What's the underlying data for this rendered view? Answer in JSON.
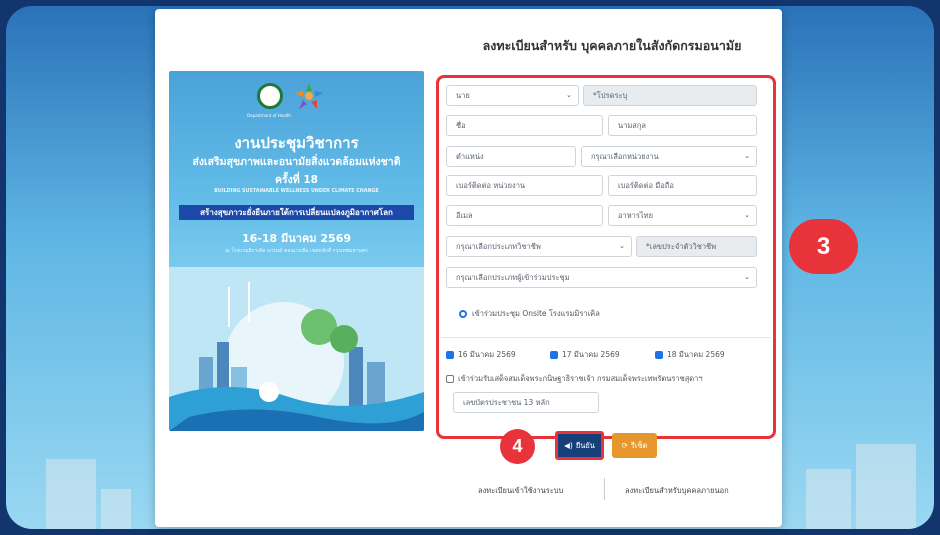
{
  "page": {
    "title": "ลงทะเบียนสำหรับ บุคคลภายในสังกัดกรมอนามัย"
  },
  "poster": {
    "logo_caption": "Department of Health",
    "title_line1": "งานประชุมวิชาการ",
    "title_line2": "ส่งเสริมสุขภาพและอนามัยสิ่งแวดล้อมแห่งชาติ",
    "title_line3": "ครั้งที่ 18",
    "subtitle_en": "BUILDING SUSTAINABLE WELLNESS UNDER CLIMATE CHANGE",
    "banner": "สร้างสุขภาวะยั่งยืนภายใต้การเปลี่ยนแปลงภูมิอากาศโลก",
    "date": "16-18 มีนาคม 2569",
    "venue": "ณ โรงแรมมิราเคิล แกรนด์ คอนเวนชั่น เขตหลักสี่ กรุงเทพมหานคร"
  },
  "form": {
    "title_select": "นาย",
    "title_other_placeholder": "*โปรดระบุ",
    "first_name_placeholder": "ชื่อ",
    "last_name_placeholder": "นามสกุล",
    "position_placeholder": "ตำแหน่ง",
    "unit_select": "กรุณาเลือกหน่วยงาน",
    "office_phone_placeholder": "เบอร์ติดต่อ หน่วยงาน",
    "mobile_placeholder": "เบอร์ติดต่อ มือถือ",
    "email_placeholder": "อีเมล",
    "food_select": "อาหารไทย",
    "profession_select": "กรุณาเลือกประเภทวิชาชีพ",
    "license_placeholder": "*เลขประจำตัววิชาชีพ",
    "attendee_type_select": "กรุณาเลือกประเภทผู้เข้าร่วมประชุม",
    "onsite_radio_label": "เข้าร่วมประชุม Onsite โรงแรมมิราเคิล",
    "dates": [
      {
        "label": "16 มีนาคม 2569",
        "checked": true
      },
      {
        "label": "17 มีนาคม 2569",
        "checked": true
      },
      {
        "label": "18 มีนาคม 2569",
        "checked": true
      }
    ],
    "royal_checkbox_label": "เข้าร่วมรับเสด็จสมเด็จพระกนิษฐาธิราชเจ้า กรมสมเด็จพระเทพรัตนราชสุดาฯ",
    "id_card_placeholder": "เลขบัตรประชาชน 13 หลัก"
  },
  "buttons": {
    "confirm_label": "ยืนยัน",
    "reset_label": "รีเซ็ต"
  },
  "annotations": {
    "step3": "3",
    "step4": "4"
  },
  "footer": {
    "login_link": "ลงทะเบียนเข้าใช้งานระบบ",
    "external_link": "ลงทะเบียนสำหรับบุคคลภายนอก"
  },
  "colors": {
    "highlight": "#e8333a",
    "confirm_button": "#17407a",
    "reset_button": "#e7962b",
    "checkbox": "#1f73e6"
  },
  "icons": {
    "confirm": "speaker-icon",
    "reset": "refresh-icon",
    "select": "chevron-down-icon"
  }
}
